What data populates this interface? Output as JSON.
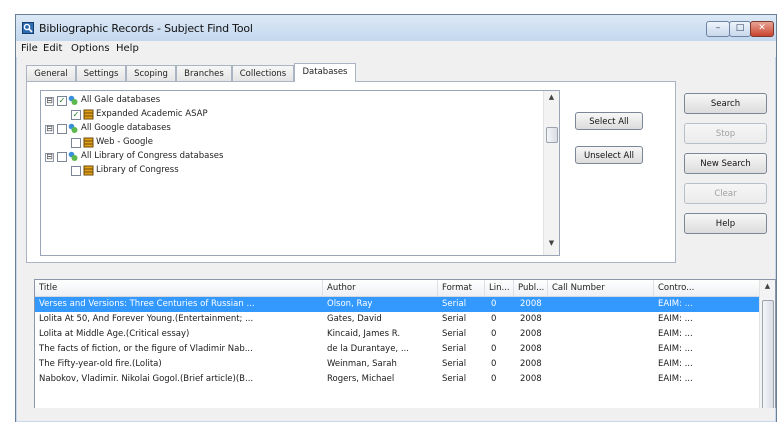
{
  "window": {
    "title": "Bibliographic Records - Subject Find Tool",
    "controls": {
      "minimize": "–",
      "maximize": "□",
      "close": "✕"
    }
  },
  "menu": [
    "File",
    "Edit",
    "Options",
    "Help"
  ],
  "tabs": [
    {
      "label": "General"
    },
    {
      "label": "Settings"
    },
    {
      "label": "Scoping"
    },
    {
      "label": "Branches"
    },
    {
      "label": "Collections"
    },
    {
      "label": "Databases",
      "active": true
    }
  ],
  "tree": [
    {
      "label": "All Gale databases",
      "expander": "⊟",
      "checked": true,
      "icon": "database-group-icon"
    },
    {
      "label": "Expanded Academic ASAP",
      "checked": true,
      "icon": "database-icon"
    },
    {
      "label": "All Google databases",
      "expander": "⊟",
      "checked": false,
      "icon": "database-group-icon"
    },
    {
      "label": "Web - Google",
      "checked": false,
      "icon": "database-icon"
    },
    {
      "label": "All Library of Congress databases",
      "expander": "⊟",
      "checked": false,
      "icon": "database-group-icon"
    },
    {
      "label": "Library of Congress",
      "checked": false,
      "icon": "database-icon"
    }
  ],
  "panel_buttons": {
    "select_all": "Select All",
    "unselect_all": "Unselect All"
  },
  "side_buttons": {
    "search": "Search",
    "stop": "Stop",
    "new_search": "New Search",
    "clear": "Clear",
    "help": "Help"
  },
  "results": {
    "columns": [
      "Title",
      "Author",
      "Format",
      "Lin...",
      "Publ...",
      "Call Number",
      "Contro..."
    ],
    "rows": [
      [
        "Verses and Versions: Three Centuries of Russian ...",
        "Olson, Ray",
        "Serial",
        "0",
        "2008",
        "",
        "EAIM: ..."
      ],
      [
        "Lolita At 50, And Forever Young.(Entertainment; ...",
        "Gates, David",
        "Serial",
        "0",
        "2008",
        "",
        "EAIM: ..."
      ],
      [
        "Lolita at Middle Age.(Critical essay)",
        "Kincaid, James R.",
        "Serial",
        "0",
        "2008",
        "",
        "EAIM: ..."
      ],
      [
        "The facts of fiction, or the figure of Vladimir Nab...",
        "de la Durantaye, ...",
        "Serial",
        "0",
        "2008",
        "",
        "EAIM: ..."
      ],
      [
        "The Fifty-year-old fire.(Lolita)",
        "Weinman, Sarah",
        "Serial",
        "0",
        "2008",
        "",
        "EAIM: ..."
      ],
      [
        "Nabokov, Vladimir. Nikolai Gogol.(Brief article)(B...",
        "Rogers, Michael",
        "Serial",
        "0",
        "2008",
        "",
        "EAIM: ..."
      ]
    ],
    "selected_row": 0
  },
  "colors": {
    "selection": "#3399ff",
    "window_frame": "#6b7f99",
    "check": "#1e7a1e"
  }
}
